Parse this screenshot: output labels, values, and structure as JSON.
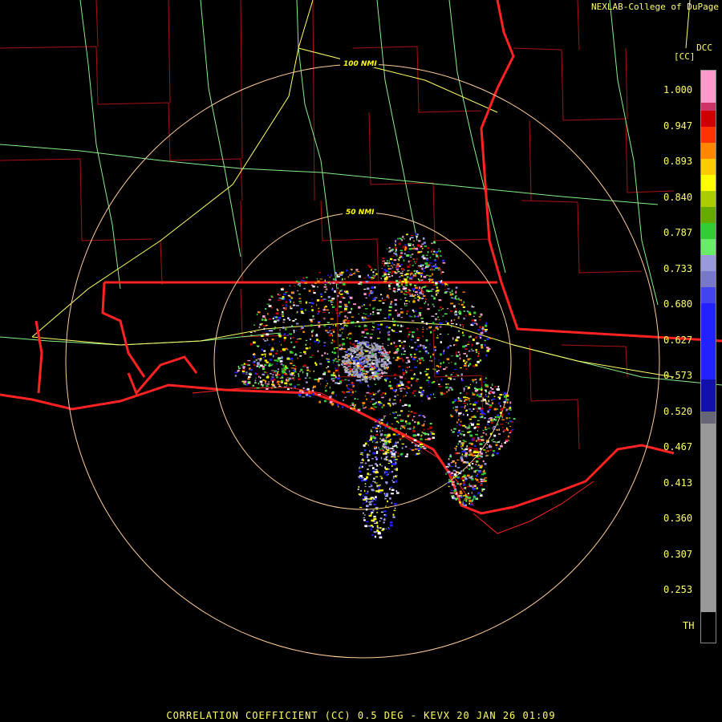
{
  "header": {
    "credit": "NEXLAB-College of DuPage",
    "site_code": "DCC",
    "unit": "[CC]"
  },
  "range_rings": [
    {
      "label": "100 NMI"
    },
    {
      "label": "50 NMI"
    }
  ],
  "colorbar": {
    "labels": [
      "1.000",
      "0.947",
      "0.893",
      "0.840",
      "0.787",
      "0.733",
      "0.680",
      "0.627",
      "0.573",
      "0.520",
      "0.467",
      "0.413",
      "0.360",
      "0.307",
      "0.253",
      "TH"
    ],
    "colors": {
      "top_pink": "#ff99cc",
      "red": "#cc0000",
      "orange": "#ff8800",
      "yellow": "#ffff00",
      "green": "#33cc33",
      "lavender": "#9999dd",
      "blue": "#2222ff",
      "gray": "#999999"
    }
  },
  "map_colors": {
    "state_border": "#ff2222",
    "county_line": "#aa1111",
    "highway": "#ffff66",
    "road": "#88ee88",
    "range_ring": "#ffcc99"
  },
  "footer": {
    "caption": "CORRELATION COEFFICIENT (CC) 0.5 DEG - KEVX 20 JAN 26 01:09"
  }
}
